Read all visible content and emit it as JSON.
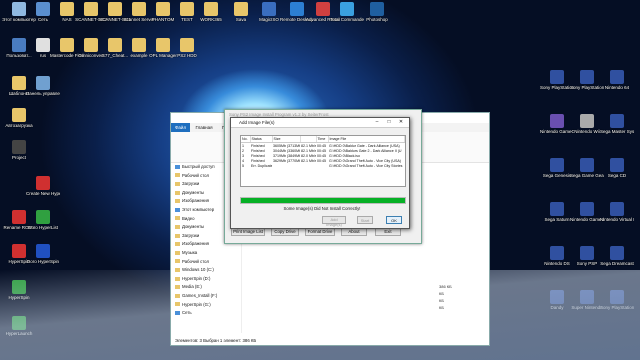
{
  "desktop": {
    "icons": [
      {
        "label": "Этот компьютер",
        "color": "#8fb8e0"
      },
      {
        "label": "Сеть",
        "color": "#5a8fd0"
      },
      {
        "label": "NAS",
        "color": "#e8c66a"
      },
      {
        "label": "SCANNET-SG3",
        "color": "#e8c66a"
      },
      {
        "label": "SCANNET-SG1",
        "color": "#e8c66a"
      },
      {
        "label": "Scannet Server",
        "color": "#e8c66a"
      },
      {
        "label": "PHANTOM",
        "color": "#e8c66a"
      },
      {
        "label": "TEST",
        "color": "#e8c66a"
      },
      {
        "label": "WORK365",
        "color": "#e8c66a"
      },
      {
        "label": "Sava",
        "color": "#e8c66a"
      },
      {
        "label": "MagicISO",
        "color": "#3a6ec0"
      },
      {
        "label": "Remote Desktop...",
        "color": "#2c7fd3"
      },
      {
        "label": "Advanced Renamer",
        "color": "#d04040"
      },
      {
        "label": "Total Commander",
        "color": "#3aa0e0"
      },
      {
        "label": "Photoshop",
        "color": "#1f5fa0"
      },
      {
        "label": "Пользоват...",
        "color": "#4a7cc0"
      },
      {
        "label": "rus",
        "color": "#e0e0e0"
      },
      {
        "label": "Mastercode Finder",
        "color": "#e8c66a"
      },
      {
        "label": "Omniconvert",
        "color": "#e8c66a"
      },
      {
        "label": "S77_Cheat...",
        "color": "#e8c66a"
      },
      {
        "label": "example",
        "color": "#e8c66a"
      },
      {
        "label": "OPL Manager",
        "color": "#e8c66a"
      },
      {
        "label": "PS2 HDD",
        "color": "#e8c66a"
      },
      {
        "label": "Шаблоны",
        "color": "#e8c66a"
      },
      {
        "label": "Панель управления",
        "color": "#70a0d0"
      },
      {
        "label": "Автозагрузка",
        "color": "#e8c66a"
      },
      {
        "label": "Project",
        "color": "#444"
      },
      {
        "label": "Create New HyperList",
        "color": "#d03030"
      },
      {
        "label": "Rename ROMs",
        "color": "#d03030"
      },
      {
        "label": "Doro HyperList",
        "color": "#30a040"
      },
      {
        "label": "HyperSpin",
        "color": "#d03030"
      },
      {
        "label": "Doro HyperSpin",
        "color": "#2050c0"
      },
      {
        "label": "HyperSpin",
        "color": "#30a040"
      },
      {
        "label": "HyperLaunch",
        "color": "#30a040"
      },
      {
        "label": "Корзина",
        "color": "#bbb"
      }
    ],
    "right_icons": [
      {
        "label": "Sony PlayStation",
        "color": "#3050a0"
      },
      {
        "label": "Sony PlayStation",
        "color": "#3050a0"
      },
      {
        "label": "Nintendo 64",
        "color": "#3050a0"
      },
      {
        "label": "Nintendo GameCube",
        "color": "#6a4fb0"
      },
      {
        "label": "Nintendo Wii",
        "color": "#aaa"
      },
      {
        "label": "Sega Master System",
        "color": "#3050a0"
      },
      {
        "label": "Sega Genesis",
        "color": "#3050a0"
      },
      {
        "label": "Sega Game Gear",
        "color": "#3050a0"
      },
      {
        "label": "Sega CD",
        "color": "#3050a0"
      },
      {
        "label": "Sega Saturn",
        "color": "#3050a0"
      },
      {
        "label": "Nintendo Game Boy",
        "color": "#3050a0"
      },
      {
        "label": "Nintendo Virtual Boy",
        "color": "#3050a0"
      },
      {
        "label": "Nintendo DS",
        "color": "#3050a0"
      },
      {
        "label": "Sony PSP",
        "color": "#3050a0"
      },
      {
        "label": "Sega Dreamcast",
        "color": "#3050a0"
      },
      {
        "label": "Dandy",
        "color": "#3050a0"
      },
      {
        "label": "Super Nintendo",
        "color": "#3050a0"
      },
      {
        "label": "Sony PlayStation 2",
        "color": "#3050a0"
      }
    ]
  },
  "explorer": {
    "tabs": [
      "Файл",
      "Главная",
      "Поделиться",
      "Вид"
    ],
    "nav": [
      "Быстрый доступ",
      "Рабочий стол",
      "Загрузки",
      "Документы",
      "Изображения",
      "Этот компьютер",
      "Видео",
      "Документы",
      "Загрузки",
      "Изображения",
      "Музыка",
      "Рабочий стол",
      "Windows 10 (C:)",
      "HyperSpin (D:)",
      "Media (E:)",
      "Games_Install (F:)",
      "HyperSpin (G:)",
      "Сеть"
    ],
    "status": "Элементов: 3    Выбран 1 элемент: 386 КБ",
    "sizes": [
      "386 КБ",
      "",
      "КБ",
      "КБ",
      "КБ"
    ]
  },
  "tool": {
    "title": "Sony PS2 Image Install Program v1.2 by SeiterFrost",
    "buttons": [
      "Print Image List",
      "Copy Drive",
      "Format Drive",
      "About",
      "Exit"
    ]
  },
  "dialog": {
    "title": "Add Image File(s)",
    "columns": [
      "No.",
      "Status",
      "Size",
      "Time",
      "Image File"
    ],
    "rows": [
      [
        "1",
        "Finished",
        "3605Mb (3713Mb)",
        "82.1 Mb/s",
        "00:45",
        "G:\\HDD 0\\Baldur Gate - Dark Alliance (USA)"
      ],
      [
        "2",
        "Finished",
        "3044Mb (3360Mb)",
        "82.1 Mb/s",
        "00:45",
        "G:\\HDD 0\\Baldurs Gate 2 - Dark Alliance II (U"
      ],
      [
        "3",
        "Finished",
        "3719Mb (3849Mb)",
        "82.0 Mb/s",
        "00:45",
        "G:\\HDD 0\\Black.iso"
      ],
      [
        "4",
        "Finished",
        "3629Mb (3770Mb)",
        "82.1 Mb/s",
        "00:45",
        "G:\\HDD 0\\Grand Theft Auto - Vice City (USA)"
      ],
      [
        "5",
        "Err. Duplicate",
        "",
        "",
        "",
        "G:\\HDD 0\\Grand Theft Auto - Vice City Stories"
      ]
    ],
    "message": "Some Image(s) Did Not Install Correctly!",
    "buttons": {
      "add": "Add Image(s)",
      "start": "Start",
      "ok": "OK"
    },
    "progress": 1.0
  }
}
